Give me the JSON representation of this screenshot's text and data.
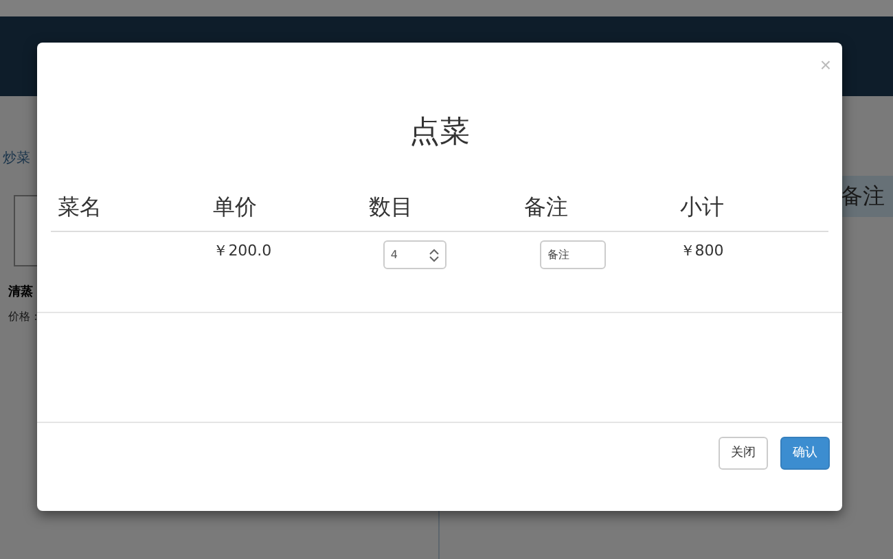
{
  "background": {
    "breadcrumb": "炒菜",
    "dish_name": "清蒸",
    "price_label": "价格：",
    "side_header": "备注"
  },
  "dialog": {
    "title": "点菜",
    "close": "×",
    "columns": [
      "菜名",
      "单价",
      "数目",
      "备注",
      "小计"
    ],
    "rows": [
      {
        "price": "￥200.0",
        "quantity": "4",
        "remark_placeholder": "备注",
        "subtotal": "￥800"
      }
    ],
    "buttons": [
      {
        "label": "关闭",
        "kind": "default"
      },
      {
        "label": "确认",
        "kind": "primary"
      }
    ]
  }
}
